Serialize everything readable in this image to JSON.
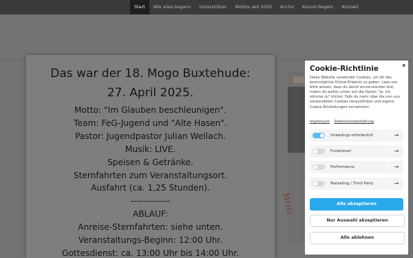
{
  "nav": {
    "items": [
      {
        "label": "Start",
        "active": true
      },
      {
        "label": "Wie alles begann",
        "active": false
      },
      {
        "label": "Unterstützer",
        "active": false
      },
      {
        "label": "Mottos seit 2005",
        "active": false
      },
      {
        "label": "Archiv",
        "active": false
      },
      {
        "label": "Konvoi-Regeln",
        "active": false
      },
      {
        "label": "Kontakt",
        "active": false
      }
    ]
  },
  "modal": {
    "title_line1": "Das war der 18. Mogo Buxtehude:",
    "title_line2": "27. April 2025.",
    "lines": [
      "Motto: \"Im Glauben beschleunigen\".",
      "Team: FeG-Jugend und \"Alte Hasen\".",
      "Pastor: Jugendpastor Julian Wellach.",
      "Musik: LIVE.",
      "Speisen & Getränke.",
      "Sternfahrten zum Veranstaltungsort.",
      "Ausfahrt (ca. 1,25 Stunden).",
      "-------------",
      "ABLAUF:",
      "Anreise-Sternfahrten: siehe unten.",
      "Veranstaltungs-Beginn: 12:00 Uhr.",
      "Gottesdienst: ca. 13:00 Uhr bis 14:00 Uhr."
    ]
  },
  "graphic": {
    "logo_text": "MOG"
  },
  "cookie": {
    "close_label": "x",
    "title": "Cookie-Richtlinie",
    "description": "Diese Website verwendet Cookies, um dir das bestmögliche Online-Erlebnis zu geben. Lass uns bitte wissen, dass du damit einverstanden bist, indem du weiter unten auf die Option \"Ja, ich stimme zu\" klickst. Falls du mehr über die von uns verwendeten Cookies herausfinden und eigene Cookie-Einstellungen vornehmen",
    "link_impressum": "Impressum",
    "link_privacy": "Datenschutzerklärung",
    "categories": [
      {
        "label": "Unbedingt erforderlich",
        "enabled": true
      },
      {
        "label": "Funktionell",
        "enabled": false
      },
      {
        "label": "Performance",
        "enabled": false
      },
      {
        "label": "Marketing / Third Party",
        "enabled": false
      }
    ],
    "arrow_glyph": "→",
    "btn_accept_all": "Alle akzeptieren",
    "btn_accept_selection": "Nur Auswahl akzeptieren",
    "btn_reject_all": "Alle ablehnen",
    "accent_color": "#29a9ea"
  }
}
